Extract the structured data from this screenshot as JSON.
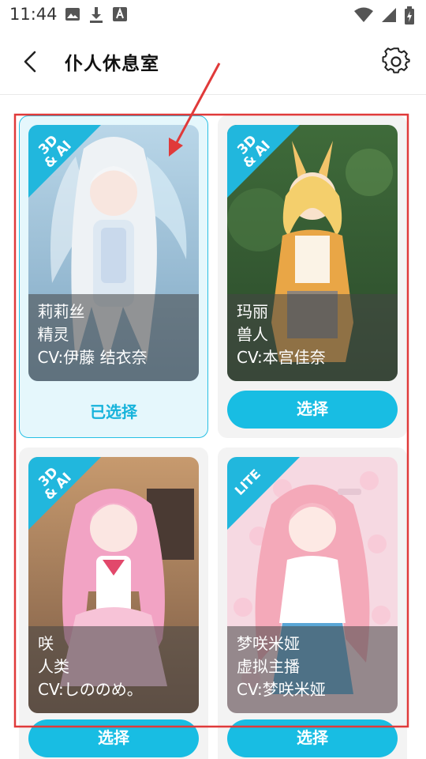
{
  "status_bar": {
    "time": "11:44"
  },
  "header": {
    "title": "仆人休息室"
  },
  "characters": [
    {
      "name": "莉莉丝",
      "type": "精灵",
      "cv": "CV:伊藤 结衣奈",
      "badge": "3D & AI",
      "badge_line1": "3D",
      "badge_line2": "& AI",
      "state_label": "已选择",
      "selected": true
    },
    {
      "name": "玛丽",
      "type": "兽人",
      "cv": "CV:本宫佳奈",
      "badge": "3D & AI",
      "badge_line1": "3D",
      "badge_line2": "& AI",
      "button_label": "选择",
      "selected": false
    },
    {
      "name": "咲",
      "type": "人类",
      "cv": "CV:しののめ。",
      "badge": "3D & AI",
      "badge_line1": "3D",
      "badge_line2": "& AI",
      "button_label": "选择",
      "selected": false
    },
    {
      "name": "梦咲米娅",
      "type": "虚拟主播",
      "cv": "CV:梦咲米娅",
      "badge": "LITE",
      "badge_line1": "LITE",
      "badge_line2": "",
      "button_label": "选择",
      "selected": false
    }
  ],
  "partial_row": {
    "left_button_label": "选择",
    "right_button_label": "选择"
  },
  "colors": {
    "accent": "#18bde3",
    "selected_bg": "#e5f7fc",
    "annotation_red": "#e03a3a"
  }
}
